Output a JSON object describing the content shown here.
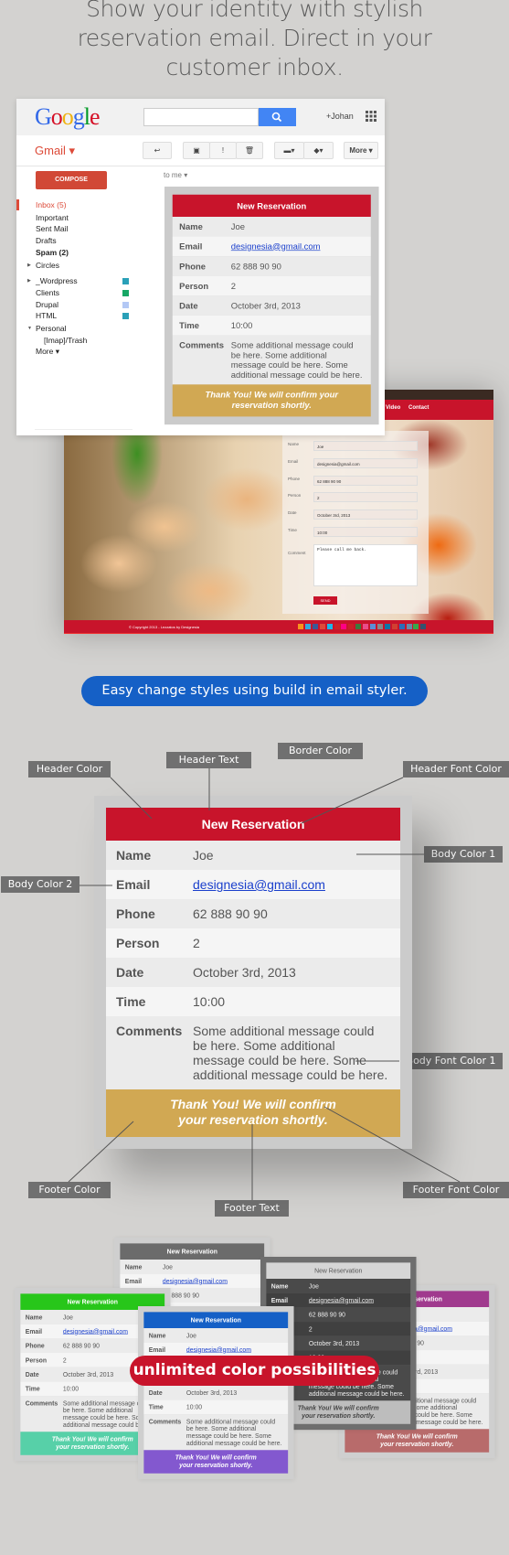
{
  "headline": [
    "Show your identity with stylish",
    "reservation email. Direct in your",
    "customer inbox."
  ],
  "gmail": {
    "logo": "Google",
    "search_placeholder": "",
    "user": "+Johan",
    "app_title": "Gmail ▾",
    "toolbar": {
      "back": "↩",
      "archive": "▣",
      "spam": "!",
      "delete": "🗑",
      "move": "▬▾",
      "labels": "◆▾",
      "more": "More ▾"
    },
    "to_me": "to me ▾",
    "compose": "COMPOSE",
    "sidebar": [
      {
        "label": "Inbox (5)",
        "active": true
      },
      {
        "label": "Important"
      },
      {
        "label": "Sent Mail"
      },
      {
        "label": "Drafts"
      },
      {
        "label": "Spam (2)",
        "bold": true
      },
      {
        "label": "Circles",
        "expandable": true
      },
      {
        "label": "_Wordpress",
        "expandable": true,
        "color": "#2aa0b8"
      },
      {
        "label": "Clients",
        "color": "#16a765"
      },
      {
        "label": "Drupal",
        "color": "#b3c8f5"
      },
      {
        "label": "HTML",
        "color": "#2aa0b8"
      },
      {
        "label": "Personal",
        "expanded": true
      },
      {
        "label": "[Imap]/Trash",
        "indent": true
      },
      {
        "label": "More ▾"
      }
    ]
  },
  "reservation": {
    "header": "New Reservation",
    "rows": [
      {
        "label": "Name",
        "value": "Joe"
      },
      {
        "label": "Email",
        "value": "designesia@gmail.com",
        "link": true
      },
      {
        "label": "Phone",
        "value": "62 888 90 90"
      },
      {
        "label": "Person",
        "value": "2"
      },
      {
        "label": "Date",
        "value": "October 3rd, 2013"
      },
      {
        "label": "Time",
        "value": "10:00"
      },
      {
        "label": "Comments",
        "value": "Some additional message could be here. Some additional message could be here. Some additional message could be here."
      }
    ],
    "footer": "Thank You! We will confirm your reservation shortly."
  },
  "website": {
    "nav": [
      "Video",
      "Contact"
    ],
    "form": [
      {
        "label": "Name",
        "value": "Joe"
      },
      {
        "label": "Email",
        "value": "designesia@gmail.com"
      },
      {
        "label": "Phone",
        "value": "62 888 90 90"
      },
      {
        "label": "Person",
        "value": "2"
      },
      {
        "label": "Date",
        "value": "October 3rd, 2013"
      },
      {
        "label": "Time",
        "value": "10:00"
      }
    ],
    "comment_label": "Comment",
    "comment_value": "Please call me back.",
    "send": "SEND",
    "copyright": "© Copyright 2013 - Lezzatos by Designesia",
    "social_colors": [
      "#f7931e",
      "#33aadd",
      "#3b5998",
      "#dd4b39",
      "#1ab7ea",
      "#cc2127",
      "#ff0084",
      "#cb2027",
      "#3d7a3d",
      "#ea4c89",
      "#5b8fd6",
      "#888888",
      "#0e76a8",
      "#d23f31",
      "#2a6ebb",
      "#6a8aa6",
      "#38a84a",
      "#34526f"
    ]
  },
  "styler": {
    "banner": "Easy change styles using build in email styler.",
    "labels": {
      "header_color": "Header Color",
      "header_text": "Header Text",
      "border_color": "Border Color",
      "header_font_color": "Header Font Color",
      "body_color_1": "Body Color 1",
      "body_color_2": "Body Color 2",
      "body_font_color_1": "Body Font Color 1",
      "footer_color": "Footer Color",
      "footer_text": "Footer Text",
      "footer_font_color": "Footer Font Color"
    }
  },
  "themes": {
    "red": {
      "header": "#c8142b",
      "header_font": "#ffffff",
      "row1": "#ebebeb",
      "row2": "#f5f5f5",
      "body_font": "#555555",
      "link": "#1a3fcc",
      "footer": "#d1a853",
      "footer_font": "#ffffff",
      "border": "#cbcbcb"
    },
    "gray": {
      "header": "#6b6b6b",
      "header_font": "#ffffff",
      "row1": "#ebebeb",
      "row2": "#f5f5f5",
      "body_font": "#555555",
      "link": "#1a3fcc",
      "footer": "#9a9a9a",
      "footer_font": "#ffffff",
      "border": "#cfcfcf"
    },
    "green": {
      "header": "#27c61a",
      "header_font": "#ffffff",
      "row1": "#ebebeb",
      "row2": "#f5f5f5",
      "body_font": "#555555",
      "link": "#1a3fcc",
      "footer": "#57d0a8",
      "footer_font": "#ffffff",
      "border": "#cfcfcf"
    },
    "dark": {
      "header": "#d6d6d6",
      "header_font": "#555555",
      "row1": "#4a4a4a",
      "row2": "#404040",
      "body_font": "#eeeeee",
      "link": "#eeeeee",
      "footer": "#bdbdbd",
      "footer_font": "#444444",
      "border": "#6e6e6e"
    },
    "purple": {
      "header": "#a03a8e",
      "header_font": "#ffffff",
      "row1": "#ebebeb",
      "row2": "#f5f5f5",
      "body_font": "#555555",
      "link": "#1a3fcc",
      "footer": "#b86b6b",
      "footer_font": "#ffffff",
      "border": "#cfcfcf"
    },
    "blue": {
      "header": "#1560c6",
      "header_font": "#ffffff",
      "row1": "#ebebeb",
      "row2": "#f5f5f5",
      "body_font": "#555555",
      "link": "#1a3fcc",
      "footer": "#8358cf",
      "footer_font": "#ffffff",
      "border": "#cfcfcf"
    }
  },
  "showcase_banner": "unlimited color possibilities"
}
